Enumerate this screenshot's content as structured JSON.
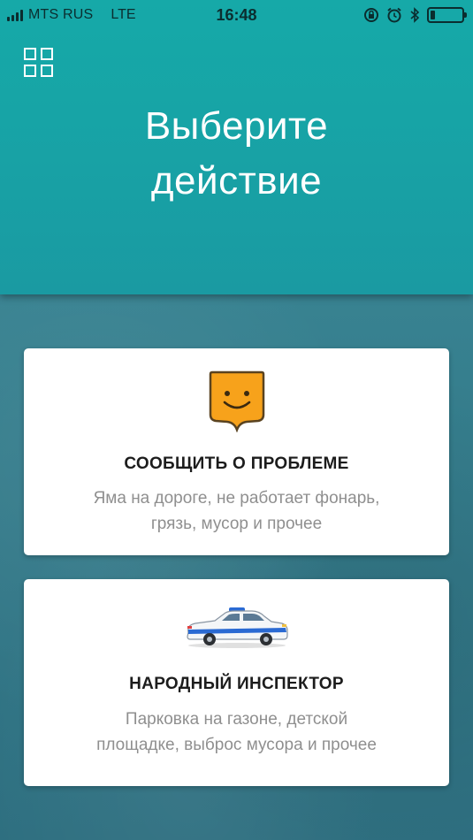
{
  "status_bar": {
    "carrier": "MTS RUS",
    "network": "LTE",
    "time": "16:48",
    "icons": [
      "signal-icon",
      "lock-rotation-icon",
      "alarm-icon",
      "bluetooth-icon",
      "battery-icon"
    ],
    "battery_level": 0.15
  },
  "header": {
    "menu_icon": "grid-icon",
    "title_line1": "Выберите",
    "title_line2": "действие",
    "color": "#17a4a6"
  },
  "actions": [
    {
      "icon": "smiley-shield-icon",
      "title": "СООБЩИТЬ О ПРОБЛЕМЕ",
      "desc_line1": "Яма на дороге, не работает фонарь,",
      "desc_line2": "грязь, мусор и прочее"
    },
    {
      "icon": "police-car-icon",
      "title": "НАРОДНЫЙ ИНСПЕКТОР",
      "desc_line1": "Парковка на газоне, детской",
      "desc_line2": "площадке, выброс мусора и прочее"
    }
  ],
  "colors": {
    "accent": "#17a4a6",
    "shield": "#f7a21b",
    "background": "#367f8e"
  }
}
